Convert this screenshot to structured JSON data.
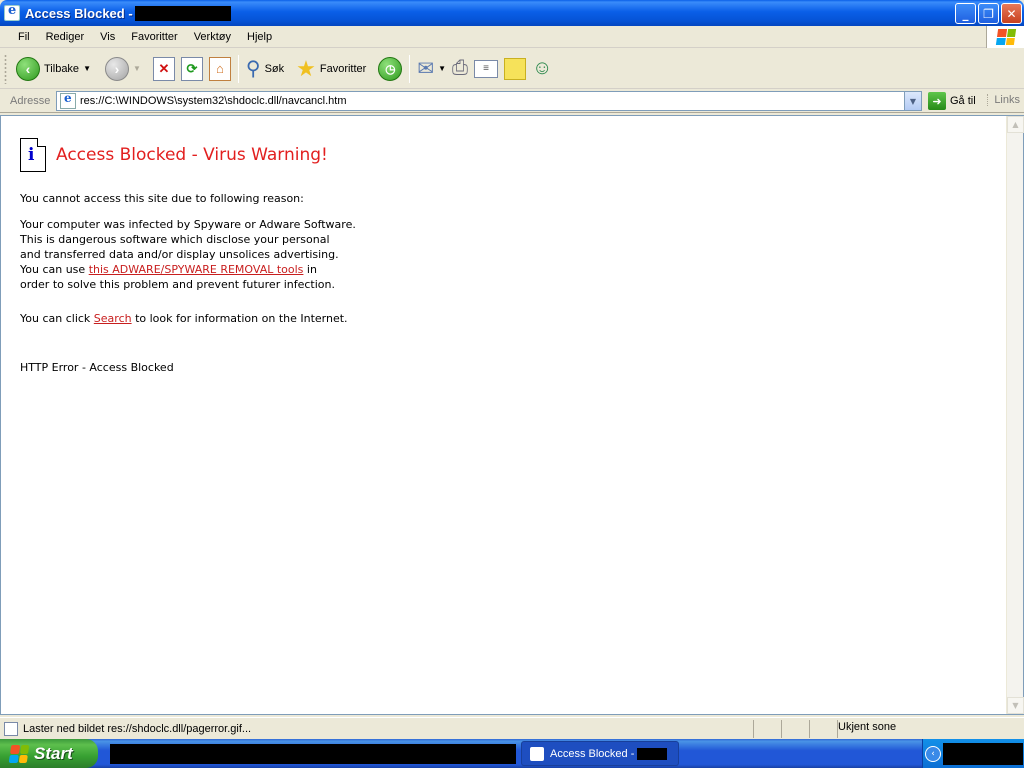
{
  "window": {
    "title": "Access Blocked -",
    "buttons": {
      "minimize": "_",
      "maximize": "❐",
      "close": "✕"
    }
  },
  "menu": [
    "Fil",
    "Rediger",
    "Vis",
    "Favoritter",
    "Verktøy",
    "Hjelp"
  ],
  "toolbar": {
    "back_label": "Tilbake",
    "search_label": "Søk",
    "favorites_label": "Favoritter"
  },
  "address": {
    "label": "Adresse",
    "value": "res://C:\\WINDOWS\\system32\\shdoclc.dll/navcancl.htm",
    "go_label": "Gå til",
    "links_label": "Links"
  },
  "page": {
    "title": "Access Blocked - Virus Warning!",
    "reason": "You cannot access this site due to following reason:",
    "para_lines": [
      "Your computer was infected by Spyware or Adware Software.",
      "This is dangerous software which disclose your personal",
      "and transferred data and/or display unsolices advertising."
    ],
    "use_prefix": "You can use ",
    "removal_link": "this ADWARE/SPYWARE REMOVAL tools",
    "use_suffix": " in",
    "last_line": "order to solve this problem and prevent futurer infection.",
    "search_prefix": "You can click ",
    "search_link": "Search",
    "search_suffix": " to look for information on the Internet.",
    "http_error": "HTTP Error - Access Blocked"
  },
  "status": {
    "text": "Laster ned bildet res://shdoclc.dll/pagerror.gif...",
    "zone": "Ukjent sone"
  },
  "taskbar": {
    "start_label": "Start",
    "active_task": "Access Blocked -"
  },
  "colors": {
    "title_red": "#e21f1f",
    "link_red": "#c81e1e",
    "taskbar_blue": "#2157d7",
    "start_green": "#37a032"
  }
}
